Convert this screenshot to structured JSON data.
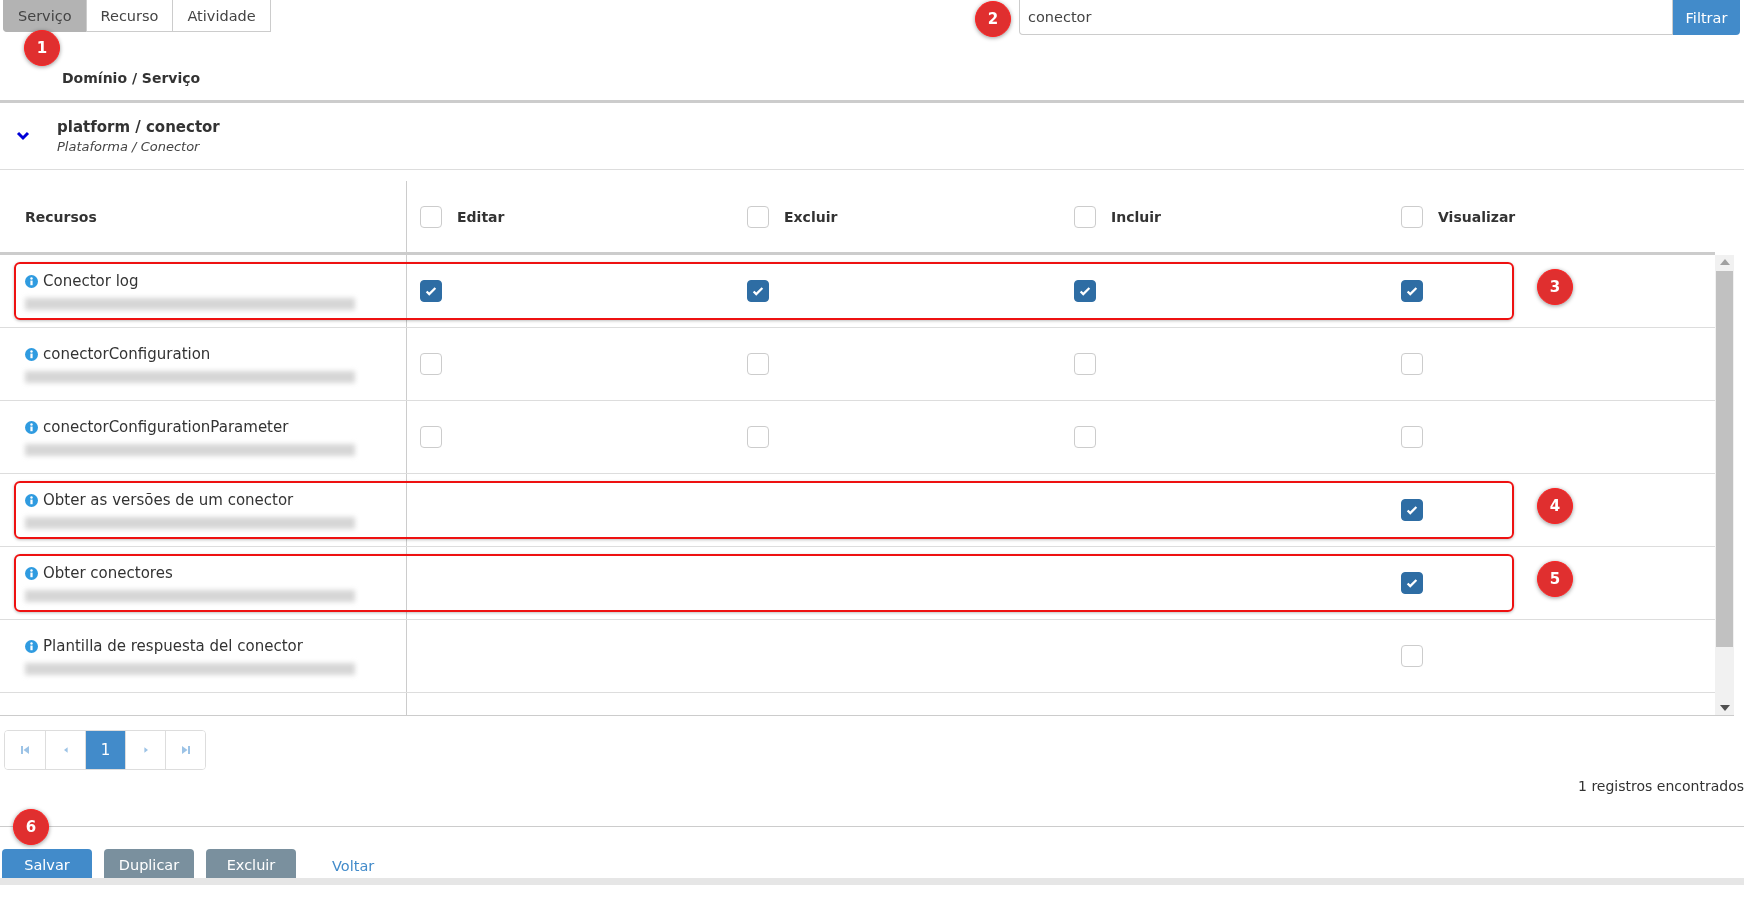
{
  "tabs": [
    {
      "label": "Serviço",
      "selected": true
    },
    {
      "label": "Recurso",
      "selected": false
    },
    {
      "label": "Atividade",
      "selected": false
    }
  ],
  "tabs_callout": "1",
  "search": {
    "value": "conector",
    "button": "Filtrar",
    "callout": "2"
  },
  "list_header": "Domínio / Serviço",
  "group": {
    "title": "platform / conector",
    "subtitle": "Plataforma / Conector",
    "expanded": true
  },
  "table": {
    "first_column": "Recursos",
    "columns": [
      {
        "label": "Editar",
        "checked": false
      },
      {
        "label": "Excluir",
        "checked": false
      },
      {
        "label": "Incluir",
        "checked": false
      },
      {
        "label": "Visualizar",
        "checked": false
      }
    ],
    "rows": [
      {
        "name": "Conector log",
        "permissions": [
          {
            "checked": true
          },
          {
            "checked": true
          },
          {
            "checked": true
          },
          {
            "checked": true
          }
        ],
        "highlighted": true,
        "callout": "3"
      },
      {
        "name": "conectorConfiguration",
        "permissions": [
          {
            "checked": false
          },
          {
            "checked": false
          },
          {
            "checked": false
          },
          {
            "checked": false
          }
        ],
        "highlighted": false
      },
      {
        "name": "conectorConfigurationParameter",
        "permissions": [
          {
            "checked": false
          },
          {
            "checked": false
          },
          {
            "checked": false
          },
          {
            "checked": false
          }
        ],
        "highlighted": false
      },
      {
        "name": "Obter as versões de um conector",
        "permissions": [
          {
            "kind": "empty"
          },
          {
            "kind": "empty"
          },
          {
            "kind": "empty"
          },
          {
            "checked": true
          }
        ],
        "highlighted": true,
        "callout": "4"
      },
      {
        "name": "Obter conectores",
        "permissions": [
          {
            "kind": "empty"
          },
          {
            "kind": "empty"
          },
          {
            "kind": "empty"
          },
          {
            "checked": true
          }
        ],
        "highlighted": true,
        "callout": "5"
      },
      {
        "name": "Plantilla de respuesta del conector",
        "permissions": [
          {
            "kind": "empty"
          },
          {
            "kind": "empty"
          },
          {
            "kind": "empty"
          },
          {
            "checked": false
          }
        ],
        "highlighted": false
      }
    ]
  },
  "pagination": {
    "pages": [
      {
        "label": "1",
        "selected": true
      }
    ]
  },
  "record_count": "1 registros encontrados",
  "actions": [
    {
      "label": "Salvar",
      "kind": "primary"
    },
    {
      "label": "Duplicar",
      "kind": "secondary"
    },
    {
      "label": "Excluir",
      "kind": "secondary"
    },
    {
      "label": "Voltar",
      "kind": "link"
    }
  ],
  "actions_callout": "6"
}
